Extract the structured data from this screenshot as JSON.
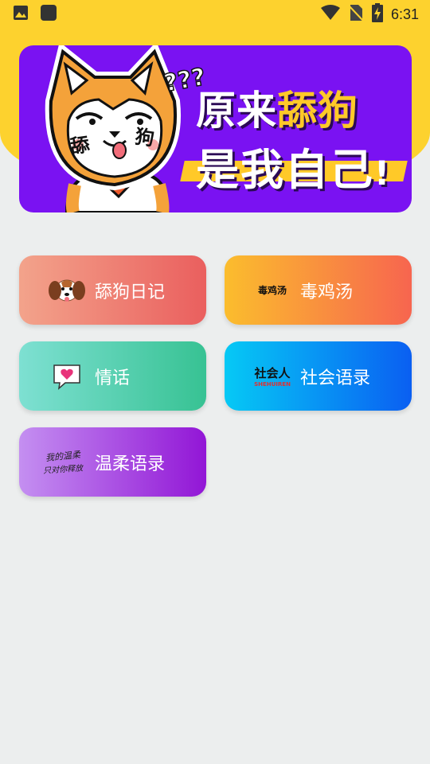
{
  "status_bar": {
    "time": "6:31",
    "icons": [
      "image-icon",
      "app-icon",
      "wifi-icon",
      "no-sim-icon",
      "battery-charging-icon"
    ]
  },
  "banner": {
    "line1_prefix": "原来",
    "line1_highlight": "舔狗",
    "line2": "是我自己",
    "exclaim": "!",
    "question_marks": "???",
    "character_tags": [
      "舔",
      "狗"
    ]
  },
  "menu": {
    "items": [
      {
        "label": "舔狗日记",
        "icon": "dog-icon"
      },
      {
        "label": "毒鸡汤",
        "icon": "poison-soup-text-icon",
        "icon_text": "毒鸡汤"
      },
      {
        "label": "情话",
        "icon": "heart-bubble-icon"
      },
      {
        "label": "社会语录",
        "icon": "society-person-icon",
        "icon_text": "社会人",
        "icon_subtext": "SHEHUIREN"
      },
      {
        "label": "温柔语录",
        "icon": "handwriting-icon",
        "icon_text": "我的温柔",
        "icon_text2": "只对你释放"
      }
    ]
  },
  "colors": {
    "header_yellow": "#fdd22e",
    "banner_purple": "#7a12f2",
    "banner_highlight": "#ffc928",
    "background": "#eceeee"
  }
}
